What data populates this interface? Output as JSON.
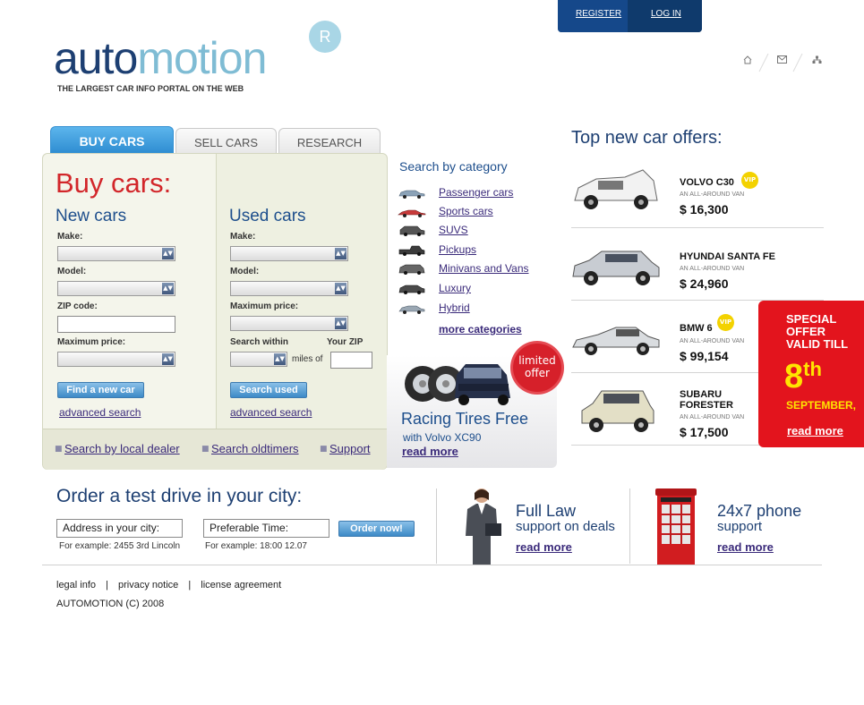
{
  "topbar": {
    "register": "REGISTER",
    "login": "LOG IN"
  },
  "logo": {
    "part1": "auto",
    "part2": "motion",
    "mark": "R",
    "tagline": "THE LARGEST CAR INFO PORTAL ON THE WEB"
  },
  "icons": {
    "home": "home-icon",
    "mail": "mail-icon",
    "sitemap": "sitemap-icon"
  },
  "tabs": [
    "BUY CARS",
    "SELL CARS",
    "RESEARCH"
  ],
  "buy": {
    "title": "Buy cars:",
    "new": {
      "heading": "New cars",
      "make_label": "Make:",
      "model_label": "Model:",
      "zip_label": "ZIP code:",
      "maxprice_label": "Maximum price:",
      "button": "Find a new car",
      "advanced": "advanced search"
    },
    "used": {
      "heading": "Used cars",
      "make_label": "Make:",
      "model_label": "Model:",
      "maxprice_label": "Maximum price:",
      "within_label": "Search within",
      "zip_label": "Your ZIP",
      "miles_of": "miles of",
      "button": "Search used",
      "advanced": "advanced search"
    },
    "bottom_links": [
      "Search by local dealer",
      "Search oldtimers",
      "Support"
    ]
  },
  "categories": {
    "heading": "Search by category",
    "items": [
      "Passenger cars",
      "Sports cars",
      "SUVS",
      "Pickups",
      "Minivans and Vans",
      "Luxury",
      "Hybrid"
    ],
    "more": "more categories"
  },
  "tires": {
    "badge_line1": "limited",
    "badge_line2": "offer",
    "title": "Racing Tires Free",
    "subtitle": "with Volvo XC90",
    "read_more": "read more"
  },
  "offers": {
    "heading": "Top new car offers:",
    "items": [
      {
        "name": "VOLVO C30",
        "kind": "AN ALL-AROUND VAN",
        "price": "$ 16,300",
        "vip": "VIP"
      },
      {
        "name": "HYUNDAI SANTA FE",
        "kind": "AN ALL-AROUND VAN",
        "price": "$ 24,960",
        "vip": ""
      },
      {
        "name": "BMW 6",
        "kind": "AN ALL-AROUND VAN",
        "price": "$ 99,154",
        "vip": "VIP"
      },
      {
        "name": "SUBARU FORESTER",
        "kind": "AN ALL-AROUND VAN",
        "price": "$ 17,500",
        "vip": ""
      }
    ]
  },
  "special": {
    "line1": "SPECIAL",
    "line2": "OFFER",
    "line3": "VALID TILL",
    "day": "8",
    "day_suffix": "th",
    "month": "SEPTEMBER,",
    "read_more": "read more"
  },
  "order": {
    "title": "Order a test drive in your city:",
    "address_value": "Address in your city:",
    "address_example": "For example: 2455 3rd Lincoln",
    "time_value": "Preferable Time:",
    "time_example": "For example: 18:00 12.07",
    "button": "Order now!"
  },
  "law": {
    "title": "Full Law",
    "subtitle": "support on deals",
    "read_more": "read more"
  },
  "phone": {
    "title": "24x7 phone",
    "subtitle": "support",
    "read_more": "read more"
  },
  "footer": {
    "links": [
      "legal info",
      "privacy notice",
      "license agreement"
    ],
    "separator": "|",
    "copyright": "AUTOMOTION  (C) 2008"
  },
  "colors": {
    "brand_dark": "#1d3f72",
    "brand_light": "#7fbcd4",
    "accent_red": "#d2262a",
    "special_bg": "#e3141d",
    "special_text": "#ffe400"
  }
}
